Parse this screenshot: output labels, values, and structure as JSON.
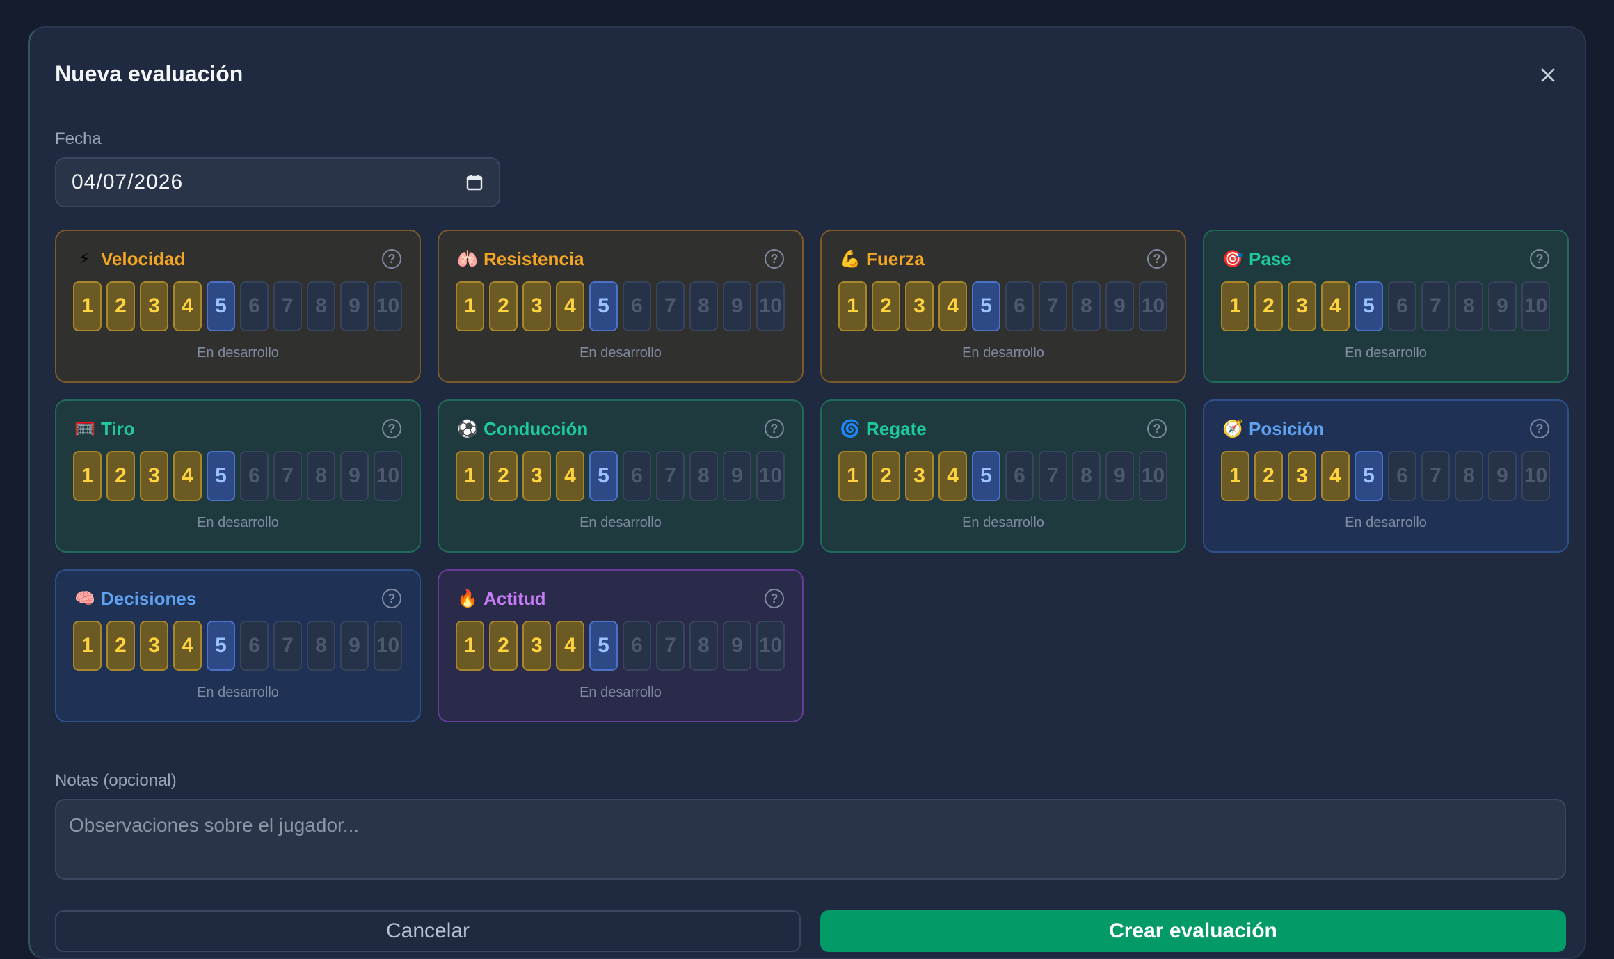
{
  "dialog": {
    "title": "Nueva evaluación",
    "close_label": "×"
  },
  "date": {
    "label": "Fecha",
    "value": "04/07/2026"
  },
  "scale_values": [
    "1",
    "2",
    "3",
    "4",
    "5",
    "6",
    "7",
    "8",
    "9",
    "10"
  ],
  "selected_value": 5,
  "attributes": [
    {
      "name": "Velocidad",
      "icon": "lightning-icon",
      "emoji": "⚡",
      "theme": "orange",
      "value": 5,
      "status": "En desarrollo"
    },
    {
      "name": "Resistencia",
      "icon": "lungs-icon",
      "emoji": "🫁",
      "theme": "orange",
      "value": 5,
      "status": "En desarrollo"
    },
    {
      "name": "Fuerza",
      "icon": "flexed-biceps-icon",
      "emoji": "💪",
      "theme": "orange",
      "value": 5,
      "status": "En desarrollo"
    },
    {
      "name": "Pase",
      "icon": "target-icon",
      "emoji": "🎯",
      "theme": "teal",
      "value": 5,
      "status": "En desarrollo"
    },
    {
      "name": "Tiro",
      "icon": "goal-net-icon",
      "emoji": "🥅",
      "theme": "teal",
      "value": 5,
      "status": "En desarrollo"
    },
    {
      "name": "Conducción",
      "icon": "soccer-ball-icon",
      "emoji": "⚽",
      "theme": "teal",
      "value": 5,
      "status": "En desarrollo"
    },
    {
      "name": "Regate",
      "icon": "spiral-icon",
      "emoji": "🌀",
      "theme": "teal",
      "value": 5,
      "status": "En desarrollo"
    },
    {
      "name": "Posición",
      "icon": "compass-icon",
      "emoji": "🧭",
      "theme": "blue",
      "value": 5,
      "status": "En desarrollo"
    },
    {
      "name": "Decisiones",
      "icon": "brain-icon",
      "emoji": "🧠",
      "theme": "blue",
      "value": 5,
      "status": "En desarrollo"
    },
    {
      "name": "Actitud",
      "icon": "fire-icon",
      "emoji": "🔥",
      "theme": "purple",
      "value": 5,
      "status": "En desarrollo"
    }
  ],
  "help_label": "?",
  "notes": {
    "label": "Notas (opcional)",
    "placeholder": "Observaciones sobre el jugador..."
  },
  "actions": {
    "cancel_label": "Cancelar",
    "create_label": "Crear evaluación"
  },
  "colors": {
    "active_fill": "#6b5a24",
    "current_fill": "#2d4a86",
    "create_button": "#029b68"
  }
}
